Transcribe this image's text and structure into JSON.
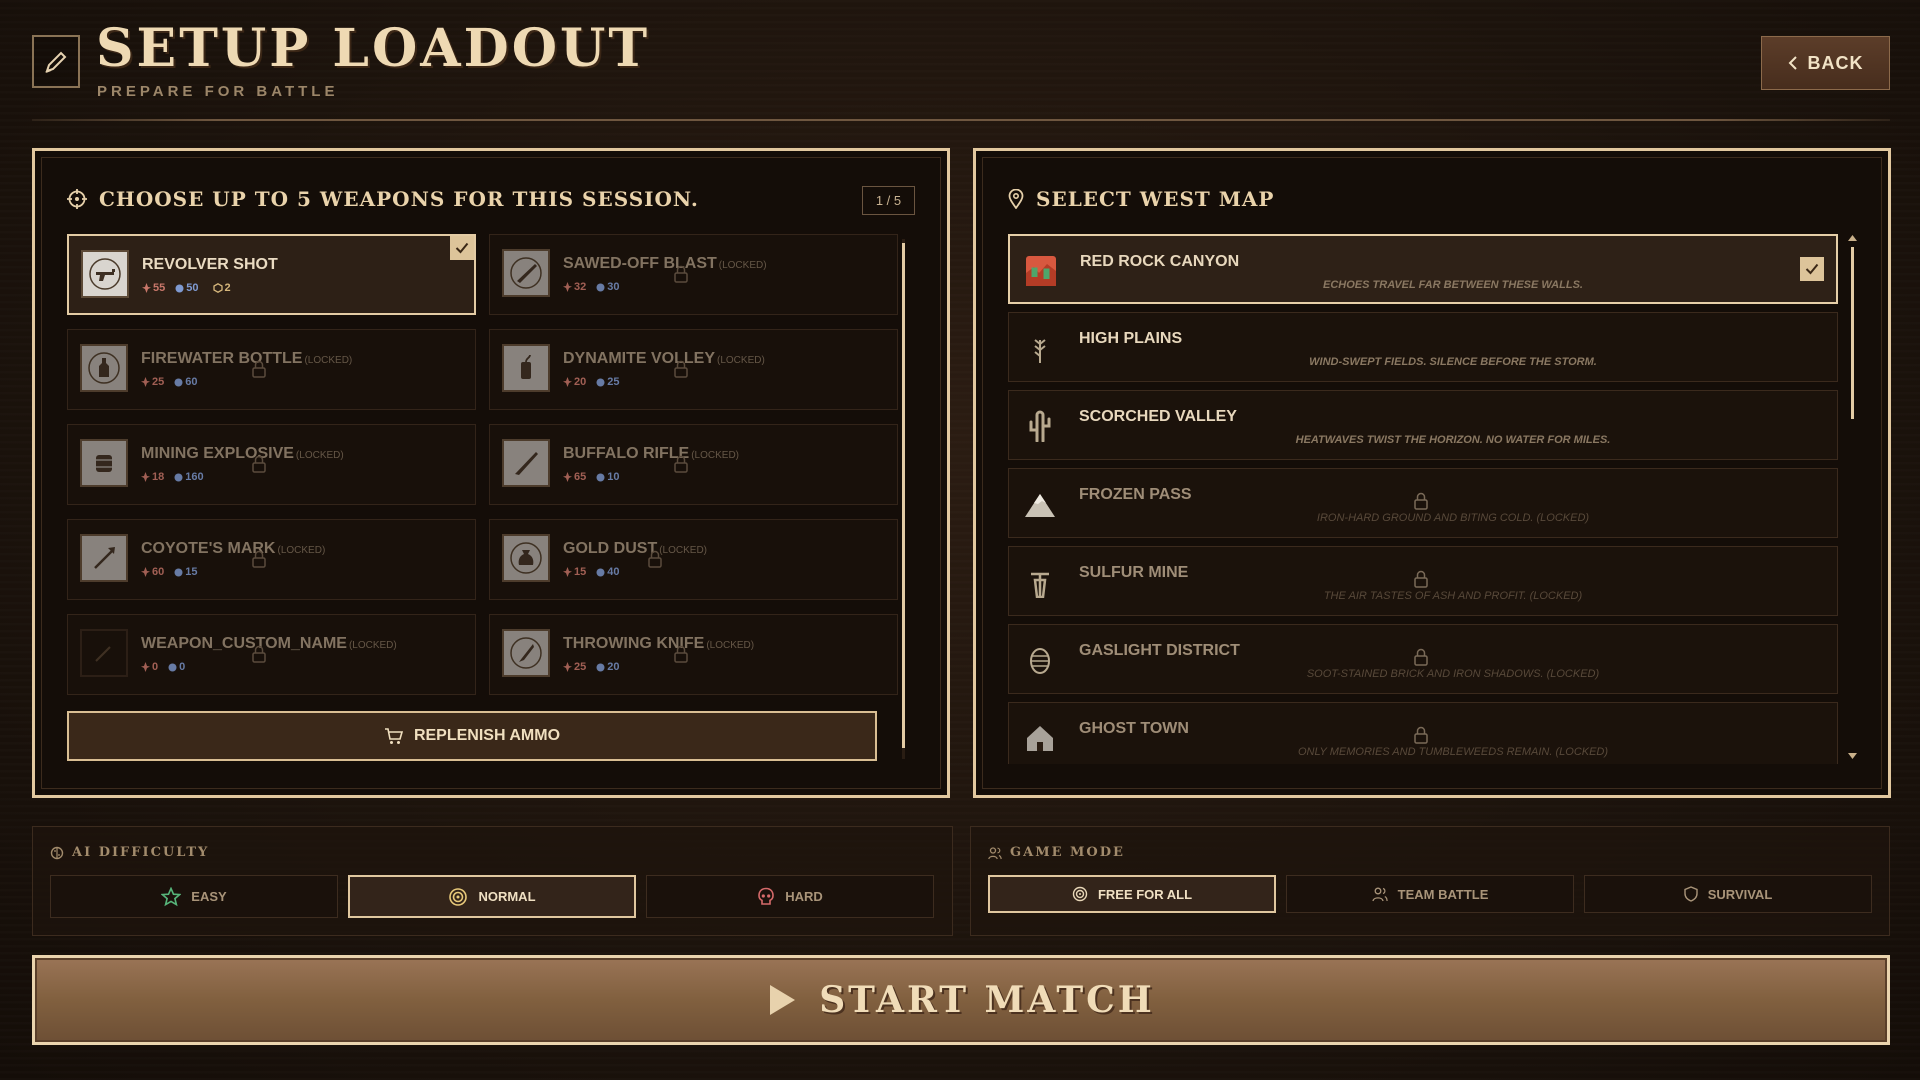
{
  "header": {
    "title": "SETUP LOADOUT",
    "subtitle": "PREPARE FOR BATTLE",
    "back_label": "BACK",
    "icon": "pen-icon"
  },
  "weapons_panel": {
    "title": "CHOOSE UP TO 5 WEAPONS FOR THIS SESSION.",
    "counter": "1 / 5",
    "locked_tag": "(LOCKED)",
    "replenish_label": "REPLENISH AMMO",
    "weapons": [
      {
        "name": "REVOLVER SHOT",
        "atk": "55",
        "def": "50",
        "gold": "2",
        "locked": false,
        "selected": true
      },
      {
        "name": "SAWED-OFF BLAST",
        "atk": "32",
        "def": "30",
        "locked": true
      },
      {
        "name": "FIREWATER BOTTLE",
        "atk": "25",
        "def": "60",
        "locked": true
      },
      {
        "name": "DYNAMITE VOLLEY",
        "atk": "20",
        "def": "25",
        "locked": true
      },
      {
        "name": "MINING EXPLOSIVE",
        "atk": "18",
        "def": "160",
        "locked": true
      },
      {
        "name": "BUFFALO RIFLE",
        "atk": "65",
        "def": "10",
        "locked": true
      },
      {
        "name": "COYOTE'S MARK",
        "atk": "60",
        "def": "15",
        "locked": true
      },
      {
        "name": "GOLD DUST",
        "atk": "15",
        "def": "40",
        "locked": true
      },
      {
        "name": "WEAPON_CUSTOM_NAME",
        "atk": "0",
        "def": "0",
        "locked": true
      },
      {
        "name": "THROWING KNIFE",
        "atk": "25",
        "def": "20",
        "locked": true
      }
    ]
  },
  "maps_panel": {
    "title": "SELECT WEST MAP",
    "maps": [
      {
        "name": "RED ROCK CANYON",
        "desc": "ECHOES TRAVEL FAR BETWEEN THESE WALLS.",
        "selected": true
      },
      {
        "name": "HIGH PLAINS",
        "desc": "WIND-SWEPT FIELDS. SILENCE BEFORE THE STORM."
      },
      {
        "name": "SCORCHED VALLEY",
        "desc": "HEATWAVES TWIST THE HORIZON. NO WATER FOR MILES."
      },
      {
        "name": "FROZEN PASS",
        "desc": "IRON-HARD GROUND AND BITING COLD. (LOCKED)",
        "locked": true
      },
      {
        "name": "SULFUR MINE",
        "desc": "THE AIR TASTES OF ASH AND PROFIT. (LOCKED)",
        "locked": true
      },
      {
        "name": "GASLIGHT DISTRICT",
        "desc": "SOOT-STAINED BRICK AND IRON SHADOWS. (LOCKED)",
        "locked": true
      },
      {
        "name": "GHOST TOWN",
        "desc": "ONLY MEMORIES AND TUMBLEWEEDS REMAIN. (LOCKED)",
        "locked": true
      }
    ]
  },
  "ai_difficulty": {
    "label": "AI DIFFICULTY",
    "options": [
      "EASY",
      "NORMAL",
      "HARD"
    ],
    "selected": "NORMAL"
  },
  "game_mode": {
    "label": "GAME MODE",
    "options": [
      "FREE FOR ALL",
      "TEAM BATTLE",
      "SURVIVAL"
    ],
    "selected": "FREE FOR ALL"
  },
  "start_label": "START MATCH",
  "colors": {
    "accent": "#e2c89f",
    "background": "#1c130c",
    "attack": "#c9776a",
    "defense": "#7f9ad1"
  }
}
